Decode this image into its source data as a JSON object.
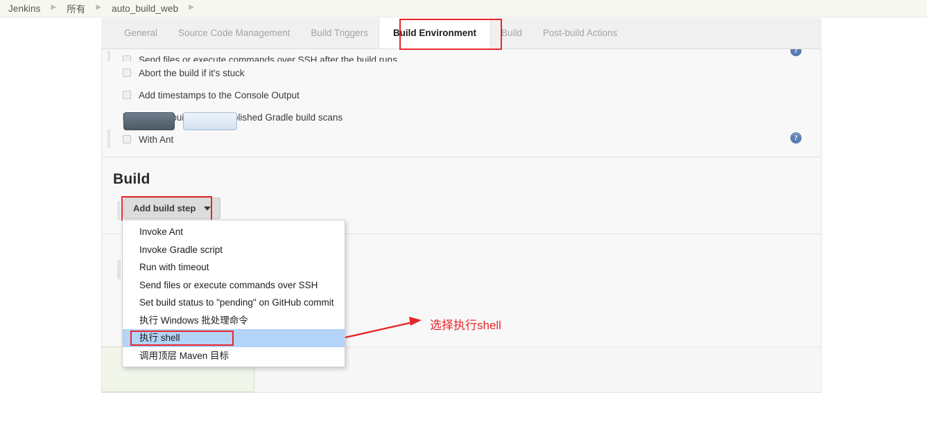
{
  "breadcrumb": {
    "items": [
      {
        "label": "Jenkins"
      },
      {
        "label": "所有"
      },
      {
        "label": "auto_build_web"
      }
    ],
    "separator": "▶"
  },
  "tabs": [
    {
      "label": "General",
      "active": false
    },
    {
      "label": "Source Code Management",
      "active": false
    },
    {
      "label": "Build Triggers",
      "active": false
    },
    {
      "label": "Build Environment",
      "active": true
    },
    {
      "label": "Build",
      "active": false
    },
    {
      "label": "Post-build Actions",
      "active": false
    }
  ],
  "build_environment": {
    "options": [
      {
        "label": "Send files or execute commands over SSH after the build runs",
        "checked": false,
        "clipped": true,
        "help": true
      },
      {
        "label": "Abort the build if it's stuck",
        "checked": false,
        "clipped": false,
        "help": false
      },
      {
        "label": "Add timestamps to the Console Output",
        "checked": false,
        "clipped": false,
        "help": false
      },
      {
        "label": "Inspect build log for published Gradle build scans",
        "checked": false,
        "clipped": false,
        "help": false
      },
      {
        "label": "With Ant",
        "checked": false,
        "clipped": false,
        "help": true
      }
    ],
    "help_glyph": "?"
  },
  "build_section": {
    "heading": "Build",
    "add_build_step_label": "Add build step",
    "caret_icon": "chevron-down-icon"
  },
  "dropdown": {
    "items": [
      {
        "label": "Invoke Ant",
        "selected": false
      },
      {
        "label": "Invoke Gradle script",
        "selected": false
      },
      {
        "label": "Run with timeout",
        "selected": false
      },
      {
        "label": "Send files or execute commands over SSH",
        "selected": false
      },
      {
        "label": "Set build status to \"pending\" on GitHub commit",
        "selected": false
      },
      {
        "label": "执行 Windows 批处理命令",
        "selected": false
      },
      {
        "label": "执行 shell",
        "selected": true
      },
      {
        "label": "调用顶层 Maven 目标",
        "selected": false
      }
    ]
  },
  "annotations": {
    "note_text": "选择执行shell",
    "color": "#e8252a"
  },
  "bottom_bar": {
    "save_label": "",
    "apply_label": ""
  }
}
